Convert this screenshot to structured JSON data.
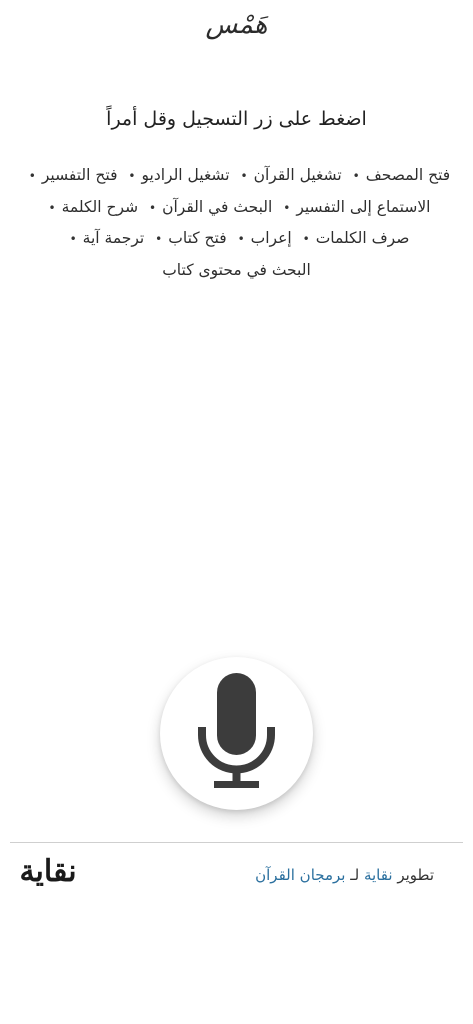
{
  "header": {
    "logo_text": "هَمْس"
  },
  "instructions": {
    "prompt": "اضغط على زر التسجيل وقل أمراً",
    "commands": [
      "فتح المصحف",
      "تشغيل القرآن",
      "تشغيل الراديو",
      "فتح التفسير",
      "الاستماع إلى التفسير",
      "البحث في القرآن",
      "شرح الكلمة",
      "صرف الكلمات",
      "إعراب",
      "فتح كتاب",
      "ترجمة آية",
      "البحث في محتوى كتاب"
    ],
    "separator": "•"
  },
  "mic": {
    "icon": "microphone-icon"
  },
  "footer": {
    "credit_prefix": "تطوير",
    "developer_link": "نقاية",
    "connector": "لـ",
    "program_link": "برمجان القرآن",
    "brand_logo_text": "نقاية"
  },
  "colors": {
    "link": "#2a6f9e",
    "mic_icon": "#3c3c3c"
  }
}
